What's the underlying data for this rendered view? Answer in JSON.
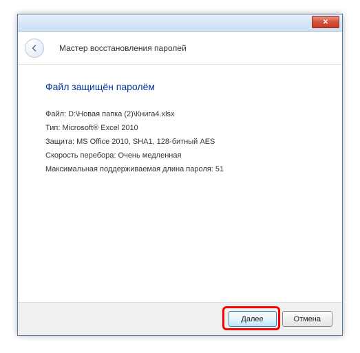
{
  "titlebar": {
    "close_symbol": "✕"
  },
  "header": {
    "wizard_title": "Мастер восстановления паролей"
  },
  "content": {
    "heading": "Файл защищён паролём",
    "file_label": "Файл:",
    "file_value": "D:\\Новая папка (2)\\Книга4.xlsx",
    "type_label": "Тип:",
    "type_value": "Microsoft® Excel 2010",
    "protection_label": "Защита:",
    "protection_value": "MS Office 2010, SHA1, 128-битный AES",
    "speed_label": "Скорость перебора:",
    "speed_value": "Очень медленная",
    "maxlen_label": "Максимальная поддерживаемая длина пароля:",
    "maxlen_value": "51"
  },
  "buttons": {
    "next": "Далее",
    "cancel": "Отмена"
  }
}
